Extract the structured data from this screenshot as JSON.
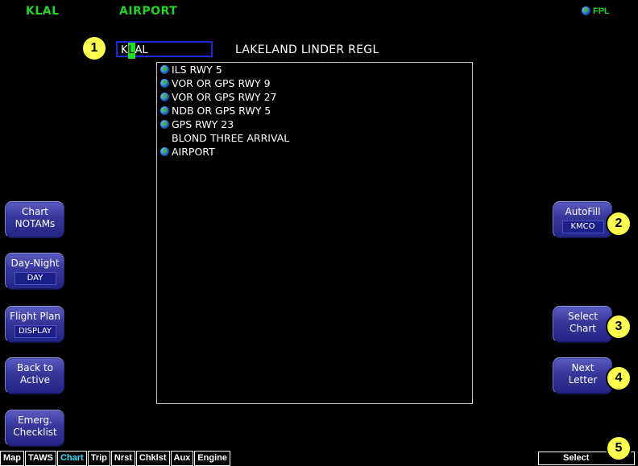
{
  "header": {
    "airport_id": "KLAL",
    "page_name": "AIRPORT",
    "fpl_label": "FPL"
  },
  "identifier": {
    "chars": [
      "K",
      "L",
      "AL"
    ],
    "airport_name": "LAKELAND LINDER REGL"
  },
  "charts": [
    {
      "label": "ILS RWY 5",
      "georef": true
    },
    {
      "label": "VOR OR GPS RWY 9",
      "georef": true
    },
    {
      "label": "VOR OR GPS RWY 27",
      "georef": true
    },
    {
      "label": "NDB OR GPS RWY 5",
      "georef": true
    },
    {
      "label": "GPS RWY 23",
      "georef": true
    },
    {
      "label": "BLOND THREE ARRIVAL",
      "georef": false
    },
    {
      "label": "AIRPORT",
      "georef": true
    }
  ],
  "left_softkeys": {
    "chart_notams": {
      "line1": "Chart",
      "line2": "NOTAMs"
    },
    "day_night": {
      "line1": "Day-Night",
      "value": "DAY"
    },
    "flight_plan": {
      "line1": "Flight Plan",
      "value": "DISPLAY"
    },
    "back_to_active": {
      "line1": "Back to",
      "line2": "Active"
    },
    "emerg_checklist": {
      "line1": "Emerg.",
      "line2": "Checklist"
    }
  },
  "right_softkeys": {
    "autofill": {
      "line1": "AutoFill",
      "value": "KMCO"
    },
    "select_chart": {
      "line1": "Select",
      "line2": "Chart"
    },
    "next_letter": {
      "line1": "Next",
      "line2": "Letter"
    }
  },
  "callouts": [
    "1",
    "2",
    "3",
    "4",
    "5"
  ],
  "tabs": [
    {
      "label": "Map",
      "active": false
    },
    {
      "label": "TAWS",
      "active": false
    },
    {
      "label": "Chart",
      "active": true
    },
    {
      "label": "Trip",
      "active": false
    },
    {
      "label": "Nrst",
      "active": false
    },
    {
      "label": "Chklst",
      "active": false
    },
    {
      "label": "Aux",
      "active": false
    },
    {
      "label": "Engine",
      "active": false
    }
  ],
  "status": {
    "select_label": "Select"
  },
  "colors": {
    "header_green": "#21d323",
    "active_tab": "#2ee6ff",
    "input_border": "#1a2bd8",
    "cursor_green": "#20e020",
    "callout_yellow": "#ffff4d",
    "softkey_blue": "#35369a"
  }
}
